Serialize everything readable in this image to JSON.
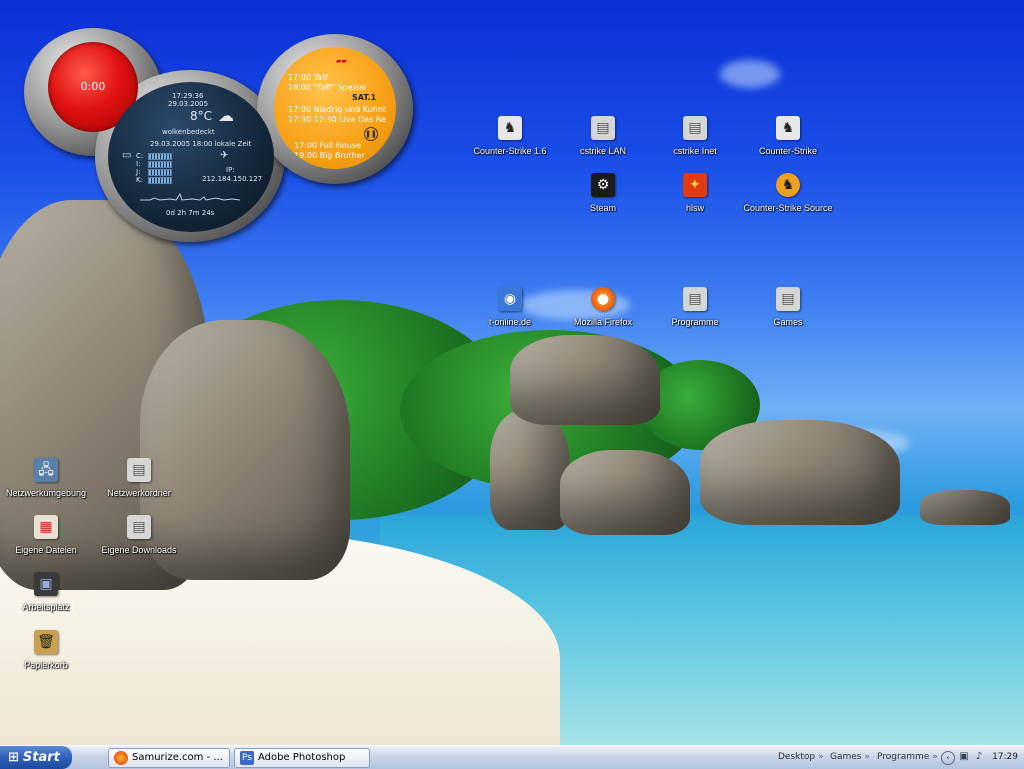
{
  "samurize_widget": {
    "rec_time": "0:00",
    "clock_time": "17:29:36",
    "clock_date": "29.03.2005",
    "temperature": "8°C",
    "weather": "wolkenbedeckt",
    "local_time": "29.03.2005  18:00 lokale Zeit",
    "drives": [
      "C:",
      "I:",
      "J:",
      "K:"
    ],
    "ip_label": "IP:",
    "ip_address": "212.184.150.127",
    "uptime": "0d 2h 7m 24s",
    "tv_schedule": [
      "17:00 Taff",
      "18:00 \"Taff\" Spezial",
      "17:00 Niedrig und Kuhnt",
      "17:30 17:30 Live Das Re",
      "17:00 Full House",
      "19:00 Big Brother"
    ]
  },
  "desktop_icons": {
    "cs16": "Counter-Strike 1.6",
    "cstrike_lan": "cstrike LAN",
    "cstrike_inet": "cstrike Inet",
    "counter_strike": "Counter-Strike",
    "steam": "Steam",
    "hlsw": "hlsw",
    "cs_source": "Counter-Strike Source",
    "t_online": "t-online.de",
    "firefox": "Mozilla Firefox",
    "programme": "Programme",
    "games": "Games",
    "netzwerkumgebung": "Netzwerkumgebung",
    "netzwerkordner": "Netzwerkordner",
    "eigene_dateien": "Eigene Dateien",
    "eigene_downloads": "Eigene Downloads",
    "arbeitsplatz": "Arbeitsplatz",
    "papierkorb": "Papierkorb"
  },
  "taskbar": {
    "start_label": "Start",
    "tasks": [
      "Samurize.com - ...",
      "Adobe Photoshop"
    ],
    "toolbar_links": [
      "Desktop",
      "Games",
      "Programme"
    ],
    "clock": "17:29"
  }
}
